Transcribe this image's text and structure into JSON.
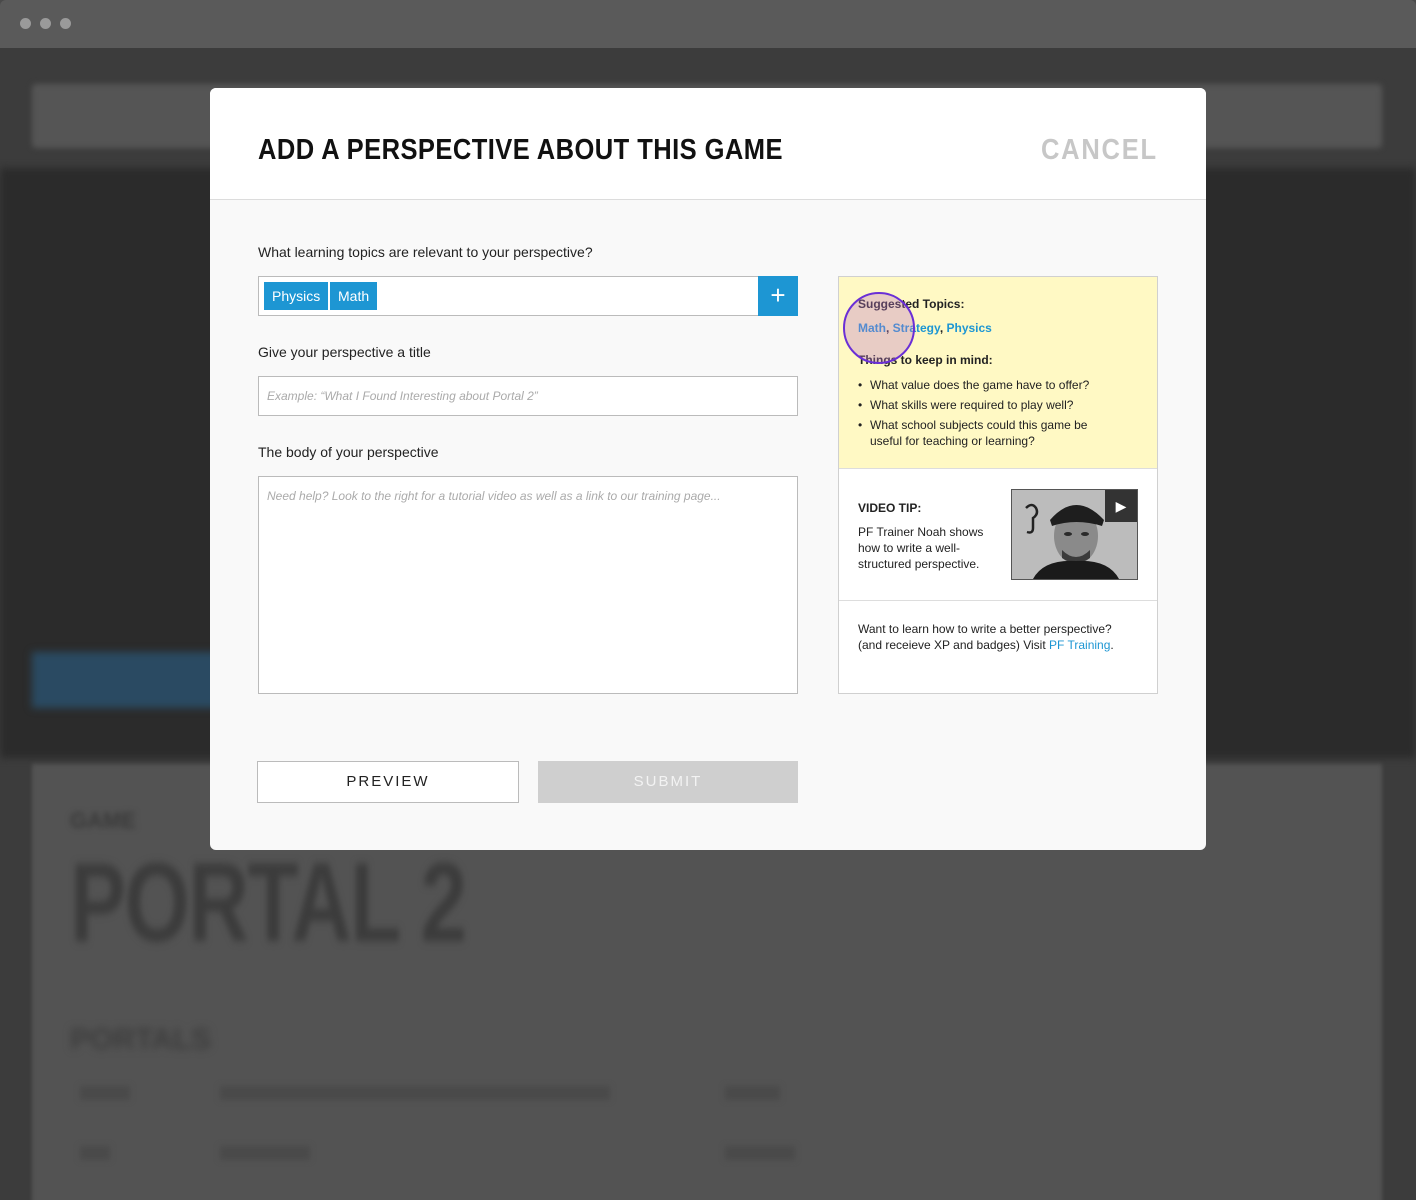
{
  "modal": {
    "title": "ADD A PERSPECTIVE ABOUT THIS GAME",
    "cancel": "CANCEL"
  },
  "form": {
    "topics_label": "What learning topics are relevant to your perspective?",
    "topics": [
      "Physics",
      "Math"
    ],
    "add_icon": "plus-icon",
    "title_label": "Give your perspective a title",
    "title_placeholder": "Example: “What I Found Interesting about Portal 2”",
    "body_label": "The body of your perspective",
    "body_placeholder": "Need help? Look to the right for a tutorial video as well as a link to our training page...",
    "preview_label": "PREVIEW",
    "submit_label": "SUBMIT"
  },
  "sidebar": {
    "suggested_label": "Suggested Topics:",
    "suggested": [
      "Math",
      "Strategy",
      "Physics"
    ],
    "keep_in_mind_label": "Things to keep in mind:",
    "tips": [
      "What value does the game have to offer?",
      "What skills were required to play well?",
      "What school subjects could this game be useful for teaching or learning?"
    ],
    "video_tip_label": "VIDEO TIP:",
    "video_tip_text": "PF Trainer Noah shows how to write a well-structured perspective.",
    "play_icon": "play-icon",
    "training_text_1": "Want to learn how to write a better perspective? (and receieve XP and badges) Visit ",
    "training_link": "PF Training",
    "training_text_2": "."
  },
  "background": {
    "label": "GAME",
    "title": "PORTAL 2",
    "subtitle": "PORTALS"
  },
  "colors": {
    "accent": "#1d96d3",
    "highlight": "#fff9c4",
    "cancel": "#c7c7c7",
    "disabled": "#cfcfcf"
  }
}
